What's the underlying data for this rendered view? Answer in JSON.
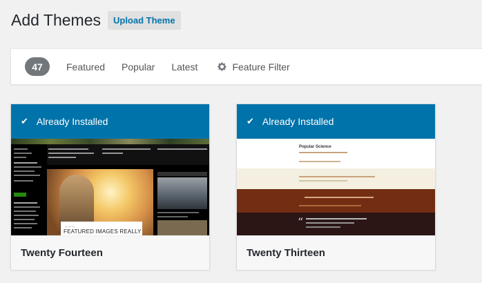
{
  "header": {
    "title": "Add Themes",
    "upload_label": "Upload Theme"
  },
  "filter_bar": {
    "count": "47",
    "links": [
      "Featured",
      "Popular",
      "Latest"
    ],
    "feature_filter_label": "Feature Filter"
  },
  "themes": [
    {
      "name": "Twenty Fourteen",
      "status": "Already Installed",
      "preview_caption": "FEATURED IMAGES REALLY"
    },
    {
      "name": "Twenty Thirteen",
      "status": "Already Installed",
      "preview_title": "Popular Science"
    }
  ],
  "colors": {
    "accent": "#0073aa",
    "count_badge": "#72777c",
    "background": "#f1f1f1"
  },
  "icons": {
    "check": "checkmark-icon",
    "gear": "gear-icon"
  }
}
